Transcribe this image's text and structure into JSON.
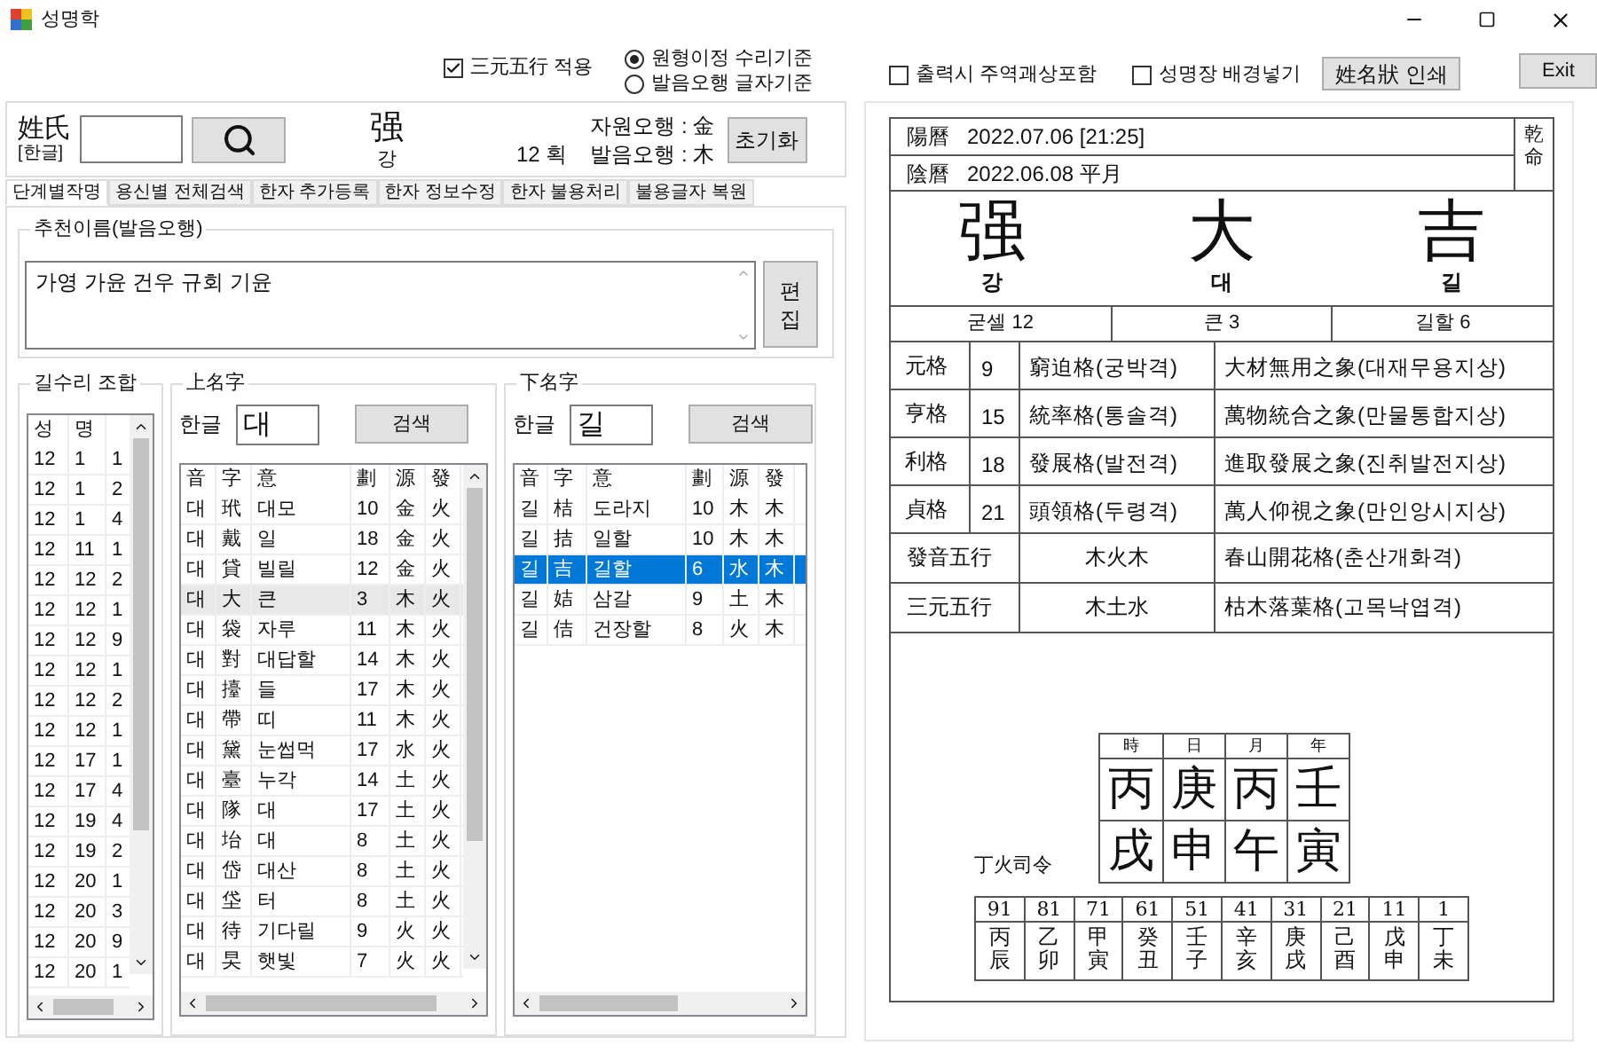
{
  "window": {
    "title": "성명학"
  },
  "options": {
    "checkbox": {
      "label": "三元五行 적용",
      "checked": true
    },
    "radios": [
      {
        "label": "원형이정 수리기준",
        "selected": true
      },
      {
        "label": "발음오행 글자기준",
        "selected": false
      }
    ]
  },
  "print_options": [
    {
      "label": "출력시 주역괘상포함",
      "checked": false
    },
    {
      "label": "성명장 배경넣기",
      "checked": false
    }
  ],
  "print_button": "姓名狀 인쇄",
  "exit_button": "Exit",
  "surname": {
    "label": "姓氏",
    "sublabel": "[한글]",
    "hanja": "强",
    "hangul": "강",
    "strokes": "12 획",
    "source_element": "자원오행 : 金",
    "sound_element": "발음오행 : 木",
    "reset_button": "초기화"
  },
  "tabs": [
    {
      "label": "단계별작명",
      "selected": true
    },
    {
      "label": "용신별 전체검색",
      "selected": false
    },
    {
      "label": "한자 추가등록",
      "selected": false
    },
    {
      "label": "한자 정보수정",
      "selected": false
    },
    {
      "label": "한자 불용처리",
      "selected": false
    },
    {
      "label": "불용글자 복원",
      "selected": false
    }
  ],
  "recommend": {
    "title": "추천이름(발음오행)",
    "value": "가영 가윤 건우 규회 기윤",
    "edit_button": "편집"
  },
  "combos": {
    "title": "길수리 조합",
    "columns": [
      "성",
      "명"
    ],
    "rows": [
      [
        "12",
        "1",
        "1"
      ],
      [
        "12",
        "1",
        "2"
      ],
      [
        "12",
        "1",
        "4"
      ],
      [
        "12",
        "11",
        "1"
      ],
      [
        "12",
        "12",
        "2"
      ],
      [
        "12",
        "12",
        "1"
      ],
      [
        "12",
        "12",
        "9"
      ],
      [
        "12",
        "12",
        "1"
      ],
      [
        "12",
        "12",
        "2"
      ],
      [
        "12",
        "12",
        "1"
      ],
      [
        "12",
        "17",
        "1"
      ],
      [
        "12",
        "17",
        "4"
      ],
      [
        "12",
        "19",
        "4"
      ],
      [
        "12",
        "19",
        "2"
      ],
      [
        "12",
        "20",
        "1"
      ],
      [
        "12",
        "20",
        "3"
      ],
      [
        "12",
        "20",
        "9"
      ],
      [
        "12",
        "20",
        "1"
      ]
    ]
  },
  "upper": {
    "title": "上名字",
    "label": "한글",
    "value": "대",
    "search_button": "검색",
    "focused": false,
    "columns": [
      "音",
      "字",
      "意",
      "劃",
      "源",
      "發"
    ],
    "rows": [
      {
        "cells": [
          "대",
          "玳",
          "대모",
          "10",
          "金",
          "火"
        ],
        "selected": false
      },
      {
        "cells": [
          "대",
          "戴",
          "일",
          "18",
          "金",
          "火"
        ],
        "selected": false
      },
      {
        "cells": [
          "대",
          "貸",
          "빌릴",
          "12",
          "金",
          "火"
        ],
        "selected": false
      },
      {
        "cells": [
          "대",
          "大",
          "큰",
          "3",
          "木",
          "火"
        ],
        "selected": true
      },
      {
        "cells": [
          "대",
          "袋",
          "자루",
          "11",
          "木",
          "火"
        ],
        "selected": false
      },
      {
        "cells": [
          "대",
          "對",
          "대답할",
          "14",
          "木",
          "火"
        ],
        "selected": false
      },
      {
        "cells": [
          "대",
          "擡",
          "들",
          "17",
          "木",
          "火"
        ],
        "selected": false
      },
      {
        "cells": [
          "대",
          "帶",
          "띠",
          "11",
          "木",
          "火"
        ],
        "selected": false
      },
      {
        "cells": [
          "대",
          "黛",
          "눈썹먹",
          "17",
          "水",
          "火"
        ],
        "selected": false
      },
      {
        "cells": [
          "대",
          "臺",
          "누각",
          "14",
          "土",
          "火"
        ],
        "selected": false
      },
      {
        "cells": [
          "대",
          "隊",
          "대",
          "17",
          "土",
          "火"
        ],
        "selected": false
      },
      {
        "cells": [
          "대",
          "坮",
          "대",
          "8",
          "土",
          "火"
        ],
        "selected": false
      },
      {
        "cells": [
          "대",
          "岱",
          "대산",
          "8",
          "土",
          "火"
        ],
        "selected": false
      },
      {
        "cells": [
          "대",
          "垈",
          "터",
          "8",
          "土",
          "火"
        ],
        "selected": false
      },
      {
        "cells": [
          "대",
          "待",
          "기다릴",
          "9",
          "火",
          "火"
        ],
        "selected": false
      },
      {
        "cells": [
          "대",
          "旲",
          "햇빛",
          "7",
          "火",
          "火"
        ],
        "selected": false
      }
    ]
  },
  "lower": {
    "title": "下名字",
    "label": "한글",
    "value": "길",
    "search_button": "검색",
    "focused": true,
    "columns": [
      "音",
      "字",
      "意",
      "劃",
      "源",
      "發"
    ],
    "rows": [
      {
        "cells": [
          "길",
          "桔",
          "도라지",
          "10",
          "木",
          "木"
        ],
        "selected": false
      },
      {
        "cells": [
          "길",
          "拮",
          "일할",
          "10",
          "木",
          "木"
        ],
        "selected": false
      },
      {
        "cells": [
          "길",
          "吉",
          "길할",
          "6",
          "水",
          "木"
        ],
        "selected": true
      },
      {
        "cells": [
          "길",
          "姞",
          "삼갈",
          "9",
          "土",
          "木"
        ],
        "selected": false
      },
      {
        "cells": [
          "길",
          "佶",
          "건장할",
          "8",
          "火",
          "木"
        ],
        "selected": false
      }
    ]
  },
  "report": {
    "solar": {
      "label": "陽曆",
      "value": "2022.07.06 [21:25]"
    },
    "lunar": {
      "label": "陰曆",
      "value": "2022.06.08 平月"
    },
    "gender": "乾命",
    "name": [
      {
        "hanja": "强",
        "hangul": "강"
      },
      {
        "hanja": "大",
        "hangul": "대"
      },
      {
        "hanja": "吉",
        "hangul": "길"
      }
    ],
    "meanings": [
      "굳셀 12",
      "큰 3",
      "길할 6"
    ],
    "grids": [
      {
        "name": "元格",
        "number": "9",
        "type": "窮迫格(궁박격)",
        "omen": "大材無用之象(대재무용지상)"
      },
      {
        "name": "亨格",
        "number": "15",
        "type": "統率格(통솔격)",
        "omen": "萬物統合之象(만물통합지상)"
      },
      {
        "name": "利格",
        "number": "18",
        "type": "發展格(발전격)",
        "omen": "進取發展之象(진취발전지상)"
      },
      {
        "name": "貞格",
        "number": "21",
        "type": "頭領格(두령격)",
        "omen": "萬人仰視之象(만인앙시지상)"
      }
    ],
    "elements": [
      {
        "name": "發音五行",
        "value": "木火木",
        "omen": "春山開花格(춘산개화격)"
      },
      {
        "name": "三元五行",
        "value": "木土水",
        "omen": "枯木落葉格(고목낙엽격)"
      }
    ],
    "saju": {
      "headers": [
        "時",
        "日",
        "月",
        "年"
      ],
      "stems": [
        "丙",
        "庚",
        "丙",
        "壬"
      ],
      "branches": [
        "戌",
        "申",
        "午",
        "寅"
      ]
    },
    "commander": "丁火司令",
    "daewoon": [
      {
        "age": "91",
        "pillar": "丙辰"
      },
      {
        "age": "81",
        "pillar": "乙卯"
      },
      {
        "age": "71",
        "pillar": "甲寅"
      },
      {
        "age": "61",
        "pillar": "癸丑"
      },
      {
        "age": "51",
        "pillar": "壬子"
      },
      {
        "age": "41",
        "pillar": "辛亥"
      },
      {
        "age": "31",
        "pillar": "庚戌"
      },
      {
        "age": "21",
        "pillar": "己酉"
      },
      {
        "age": "11",
        "pillar": "戊申"
      },
      {
        "age": "1",
        "pillar": "丁未"
      }
    ]
  }
}
